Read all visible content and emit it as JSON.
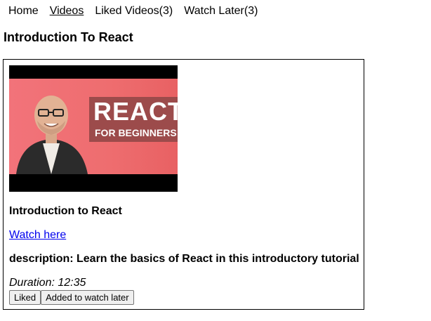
{
  "nav": {
    "items": [
      {
        "label": "Home",
        "active": false
      },
      {
        "label": "Videos",
        "active": true
      },
      {
        "label": "Liked Videos(3)",
        "active": false
      },
      {
        "label": "Watch Later(3)",
        "active": false
      }
    ]
  },
  "page": {
    "title": "Introduction To React"
  },
  "video": {
    "thumbnail": {
      "headline": "REACT",
      "subline": "FOR BEGINNERS"
    },
    "title": "Introduction to React",
    "link_label": "Watch here",
    "description": "description: Learn the basics of React in this introductory tutorial",
    "duration": "Duration: 12:35",
    "like_button": "Liked",
    "watch_later_button": "Added to watch later"
  },
  "colors": {
    "link": "#0000ee",
    "thumbnail_background": "#ee6d6f",
    "thumbnail_banner": "#9c4b4b"
  }
}
